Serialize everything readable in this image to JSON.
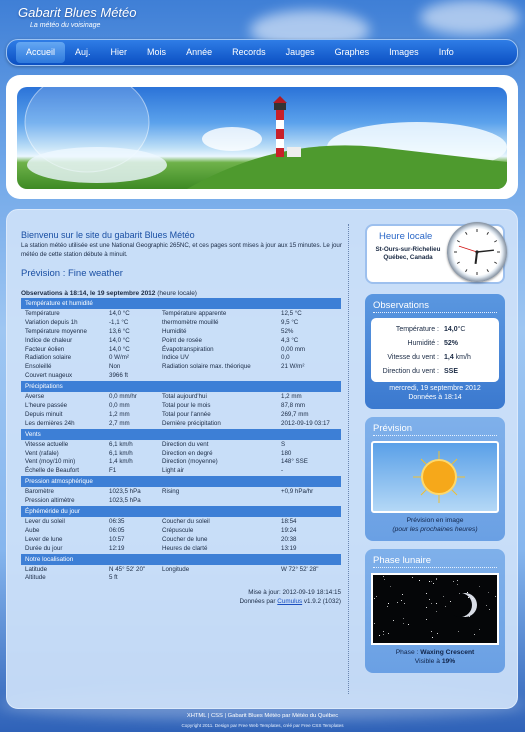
{
  "site": {
    "title": "Gabarit Blues Météo",
    "subtitle": "La météo du voisinage"
  },
  "nav": [
    {
      "label": "Accueil",
      "active": true
    },
    {
      "label": "Auj."
    },
    {
      "label": "Hier"
    },
    {
      "label": "Mois"
    },
    {
      "label": "Année"
    },
    {
      "label": "Records"
    },
    {
      "label": "Jauges"
    },
    {
      "label": "Graphes"
    },
    {
      "label": "Images"
    },
    {
      "label": "Info"
    }
  ],
  "welcome": {
    "title": "Bienvenu sur le site du gabarit Blues Météo",
    "text": "La station météo utilisée est une National Geographic 265NC, et ces pages sont mises à jour aux 15 minutes. Le jour météo de cette station débute à minuit."
  },
  "forecast": {
    "label": "Prévision : ",
    "value": "Fine weather"
  },
  "observations": {
    "title_bold": "Observations à 18:14, le 19 septembre 2012",
    "title_rest": " (heure locale)"
  },
  "sections": [
    {
      "title": "Température et humidité",
      "rows": [
        [
          "Température",
          "14,0 °C",
          "Température apparente",
          "12,5 °C"
        ],
        [
          "Variation depuis 1h",
          "-1,1 °C",
          "thermomètre mouillé",
          "9,5 °C"
        ],
        [
          "Température moyenne",
          "13,6 °C",
          "Humidité",
          "52%"
        ],
        [
          "Indice de chaleur",
          "14,0 °C",
          "Point de rosée",
          "4,3 °C"
        ],
        [
          "Facteur éolien",
          "14,0 °C",
          "Évapotranspiration",
          "0,00 mm"
        ],
        [
          "Radiation solaire",
          "0 W/m²",
          "Indice UV",
          "0,0"
        ],
        [
          "Ensoleillé",
          "Non",
          "Radiation solaire max. théorique",
          "21 W/m²"
        ],
        [
          "Couvert nuageux",
          "3966 ft",
          "",
          ""
        ]
      ]
    },
    {
      "title": "Précipitations",
      "rows": [
        [
          "Averse",
          "0,0 mm/hr",
          "Total aujourd'hui",
          "1,2 mm"
        ],
        [
          "L'heure passée",
          "0,0 mm",
          "Total pour le mois",
          "87,8 mm"
        ],
        [
          "Depuis minuit",
          "1,2 mm",
          "Total pour l'année",
          "269,7 mm"
        ],
        [
          "Les dernières 24h",
          "2,7 mm",
          "Dernière précipitation",
          "2012-09-19 03:17"
        ]
      ]
    },
    {
      "title": "Vents",
      "rows": [
        [
          "Vitesse actuelle",
          "6,1 km/h",
          "Direction du vent",
          "S"
        ],
        [
          "Vent (rafale)",
          "6,1 km/h",
          "Direction en degré",
          "180"
        ],
        [
          "Vent (moy/10 min)",
          "1,4 km/h",
          "Direction (moyenne)",
          "148° SSE"
        ],
        [
          "Échelle de Beaufort",
          "F1",
          "Light air",
          "-"
        ]
      ]
    },
    {
      "title": "Pression atmosphérique",
      "rows": [
        [
          "Baromètre",
          "1023,5 hPa",
          "Rising",
          "+0,9 hPa/hr"
        ],
        [
          "Pression altimètre",
          "1023,5 hPa",
          "",
          ""
        ]
      ]
    },
    {
      "title": "Éphéméride du jour",
      "rows": [
        [
          "Lever du soleil",
          "06:35",
          "Coucher du soleil",
          "18:54"
        ],
        [
          "Aube",
          "06:05",
          "Crépuscule",
          "19:24"
        ],
        [
          "Lever de lune",
          "10:57",
          "Coucher de lune",
          "20:38"
        ],
        [
          "Durée du jour",
          "12:19",
          "Heures de clarté",
          "13:19"
        ]
      ]
    },
    {
      "title": "Notre localisation",
      "rows": [
        [
          "Latitude",
          "N 45° 52' 20\"",
          "Longitude",
          "W 72° 52' 28\""
        ],
        [
          "Altitude",
          "5 ft",
          "",
          ""
        ]
      ]
    }
  ],
  "update": {
    "line1": "Mise à jour: 2012-09-19 18:14:15",
    "prefix": "Données par ",
    "link": "Cumulus",
    "suffix": " v1.9.2 (1032)"
  },
  "clock": {
    "title": "Heure locale",
    "location": "St-Ours-sur-Richelieu\nQuébec, Canada",
    "hour": 6,
    "minute": 14,
    "second": 48
  },
  "obs_box": {
    "title": "Observations",
    "rows": [
      {
        "label": "Température :",
        "value": "14,0",
        "unit": "°C"
      },
      {
        "label": "Humidité :",
        "value": "52%",
        "unit": ""
      },
      {
        "label": "Vitesse du vent :",
        "value": "1,4",
        "unit": " km/h"
      },
      {
        "label": "Direction du vent :",
        "value": "SSE",
        "unit": ""
      }
    ],
    "date": "mercredi, 19 septembre 2012",
    "time": "Données à 18:14"
  },
  "prevision_box": {
    "title": "Prévision",
    "caption1": "Prévision en image",
    "caption2": "(pour les prochaines heures)"
  },
  "moon_box": {
    "title": "Phase lunaire",
    "phase_label": "Phase : ",
    "phase": "Waxing Crescent",
    "visible_label": "Visible à ",
    "visible": "19%"
  },
  "footer": {
    "line1": "XHTML | CSS | Gabarit Blues Météo par Météo du Québec",
    "line2": "Copyright 2011. Design par Free Web Templates, créé par Free CSS Templates"
  },
  "colors": {
    "accent": "#1a4fa3",
    "nav": "#0b4fc2",
    "section": "#3d7fd6"
  }
}
